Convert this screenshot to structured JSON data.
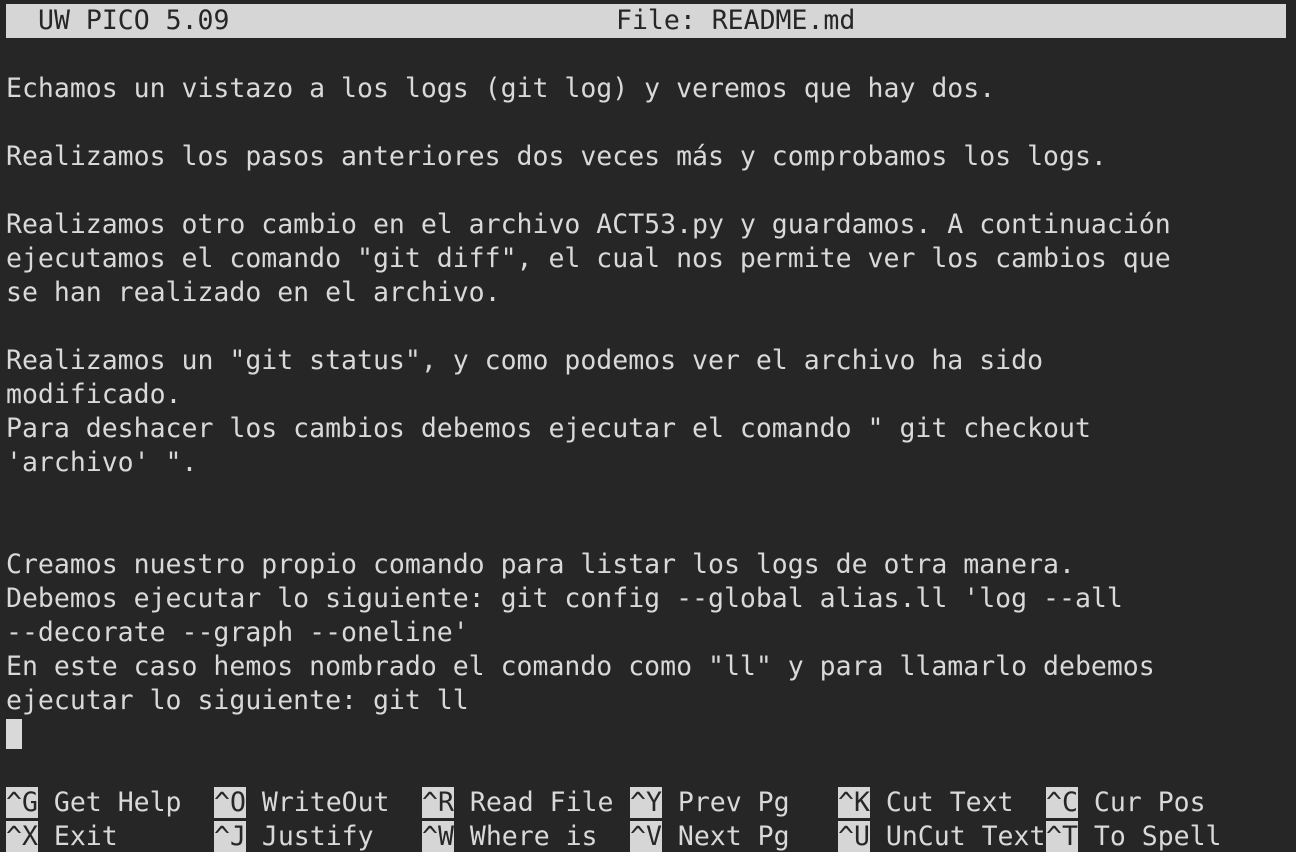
{
  "titlebar": {
    "app": "UW PICO 5.09",
    "file": "File: README.md"
  },
  "editor": {
    "lines": [
      "",
      "Echamos un vistazo a los logs (git log) y veremos que hay dos.",
      "",
      "Realizamos los pasos anteriores dos veces más y comprobamos los logs.",
      "",
      "Realizamos otro cambio en el archivo ACT53.py y guardamos. A continuación",
      "ejecutamos el comando \"git diff\", el cual nos permite ver los cambios que",
      "se han realizado en el archivo.",
      "",
      "Realizamos un \"git status\", y como podemos ver el archivo ha sido",
      "modificado.",
      "Para deshacer los cambios debemos ejecutar el comando \" git checkout",
      "'archivo' \".",
      "",
      "",
      "Creamos nuestro propio comando para listar los logs de otra manera.",
      "Debemos ejecutar lo siguiente: git config --global alias.ll 'log --all",
      "--decorate --graph --oneline'",
      "En este caso hemos nombrado el comando como \"ll\" y para llamarlo debemos",
      "ejecutar lo siguiente: git ll"
    ]
  },
  "shortcuts": {
    "row1": [
      {
        "key": "^G",
        "label": " Get Help"
      },
      {
        "key": "^O",
        "label": " WriteOut"
      },
      {
        "key": "^R",
        "label": " Read File"
      },
      {
        "key": "^Y",
        "label": " Prev Pg"
      },
      {
        "key": "^K",
        "label": " Cut Text"
      },
      {
        "key": "^C",
        "label": " Cur Pos"
      }
    ],
    "row2": [
      {
        "key": "^X",
        "label": " Exit"
      },
      {
        "key": "^J",
        "label": " Justify"
      },
      {
        "key": "^W",
        "label": " Where is"
      },
      {
        "key": "^V",
        "label": " Next Pg"
      },
      {
        "key": "^U",
        "label": " UnCut Text"
      },
      {
        "key": "^T",
        "label": " To Spell"
      }
    ]
  }
}
